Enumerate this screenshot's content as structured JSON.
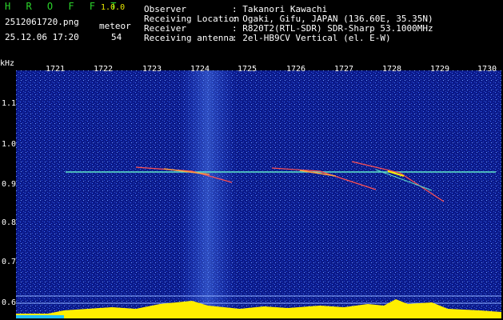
{
  "header": {
    "app_title": "H R O F F T",
    "app_version": "1.0.0",
    "filename": "2512061720.png",
    "datetime": "25.12.06 17:20",
    "meteor_label": "meteor",
    "meteor_count": "54",
    "info": [
      {
        "label": "Observer",
        "value": ": Takanori Kawachi"
      },
      {
        "label": "Receiving Location",
        "value": ": Ogaki, Gifu, JAPAN (136.60E, 35.35N)"
      },
      {
        "label": "Receiver",
        "value": ": R820T2(RTL-SDR) SDR-Sharp 53.1000MHz"
      },
      {
        "label": "Receiving antenna",
        "value": ": 2el-HB9CV Vertical (el. E-W)"
      }
    ]
  },
  "axis": {
    "y_unit": "kHz",
    "y_ticks": [
      "1.1",
      "1.0",
      "0.9",
      "0.8",
      "0.7",
      "0.6"
    ],
    "x_ticks": [
      "1721",
      "1722",
      "1723",
      "1724",
      "1725",
      "1726",
      "1727",
      "1728",
      "1729",
      "1730"
    ]
  },
  "colors": {
    "background": "#0b1a8a",
    "carrier": "#5fe6c8",
    "meteor": "#ff4040",
    "bar": "#ffee00",
    "bar_base": "#20c0ff"
  }
}
